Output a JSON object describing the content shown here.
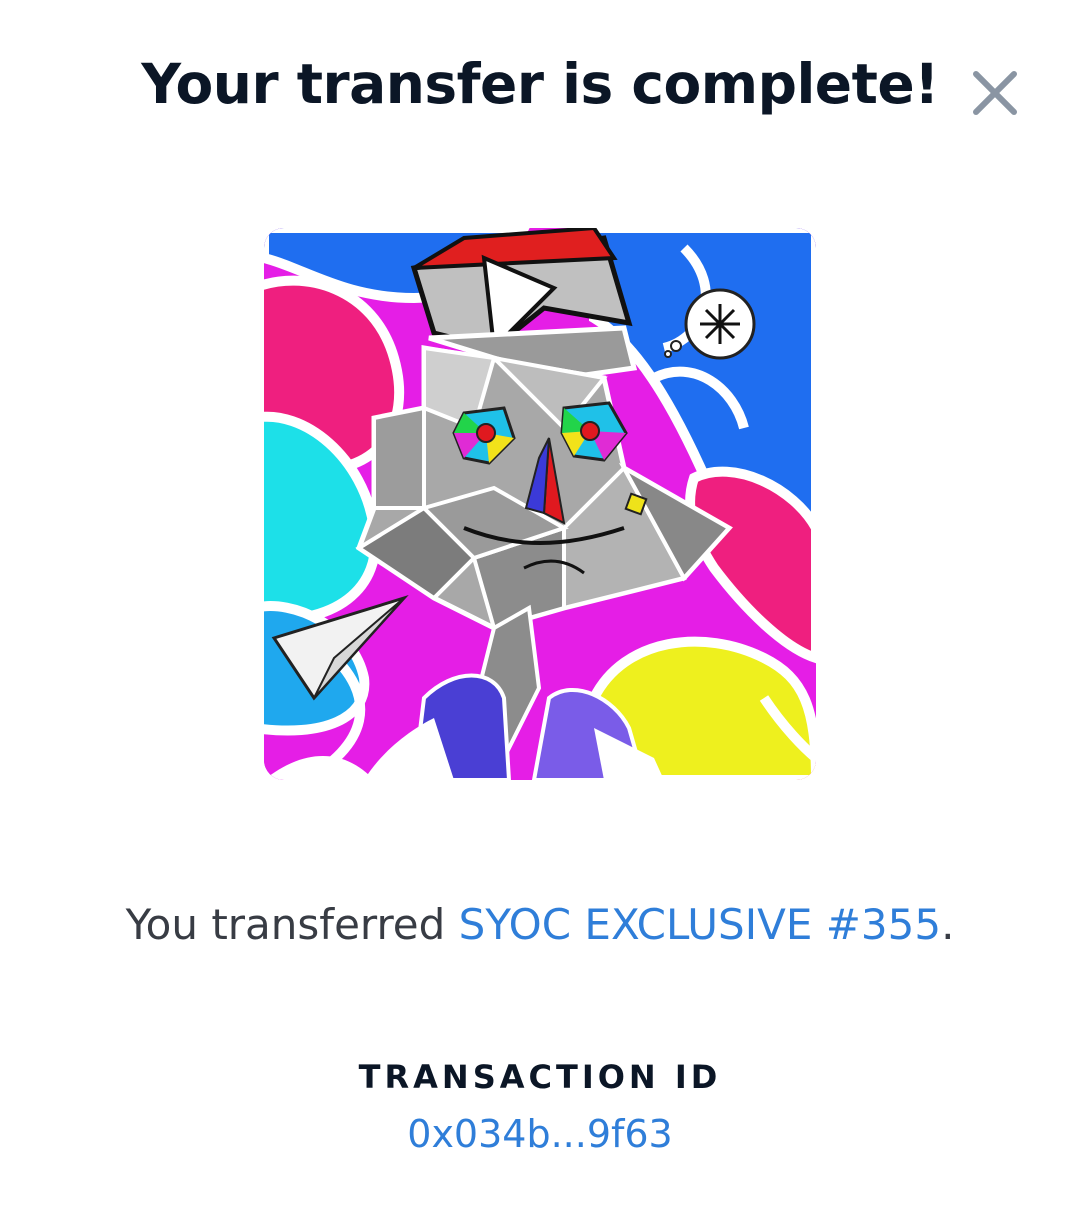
{
  "dialog": {
    "title": "Your transfer is complete!",
    "close_icon": "close-icon"
  },
  "nft": {
    "image_icon": "nft-artwork-image"
  },
  "message": {
    "prefix": "You transferred ",
    "item_name": "SYOC EXCLUSIVE #355",
    "suffix": "."
  },
  "transaction": {
    "label": "TRANSACTION ID",
    "id": "0x034b...9f63"
  },
  "colors": {
    "link": "#2f7ed9",
    "title": "#0b1626",
    "body_text": "#383c44",
    "close_icon": "#8a95a3"
  }
}
